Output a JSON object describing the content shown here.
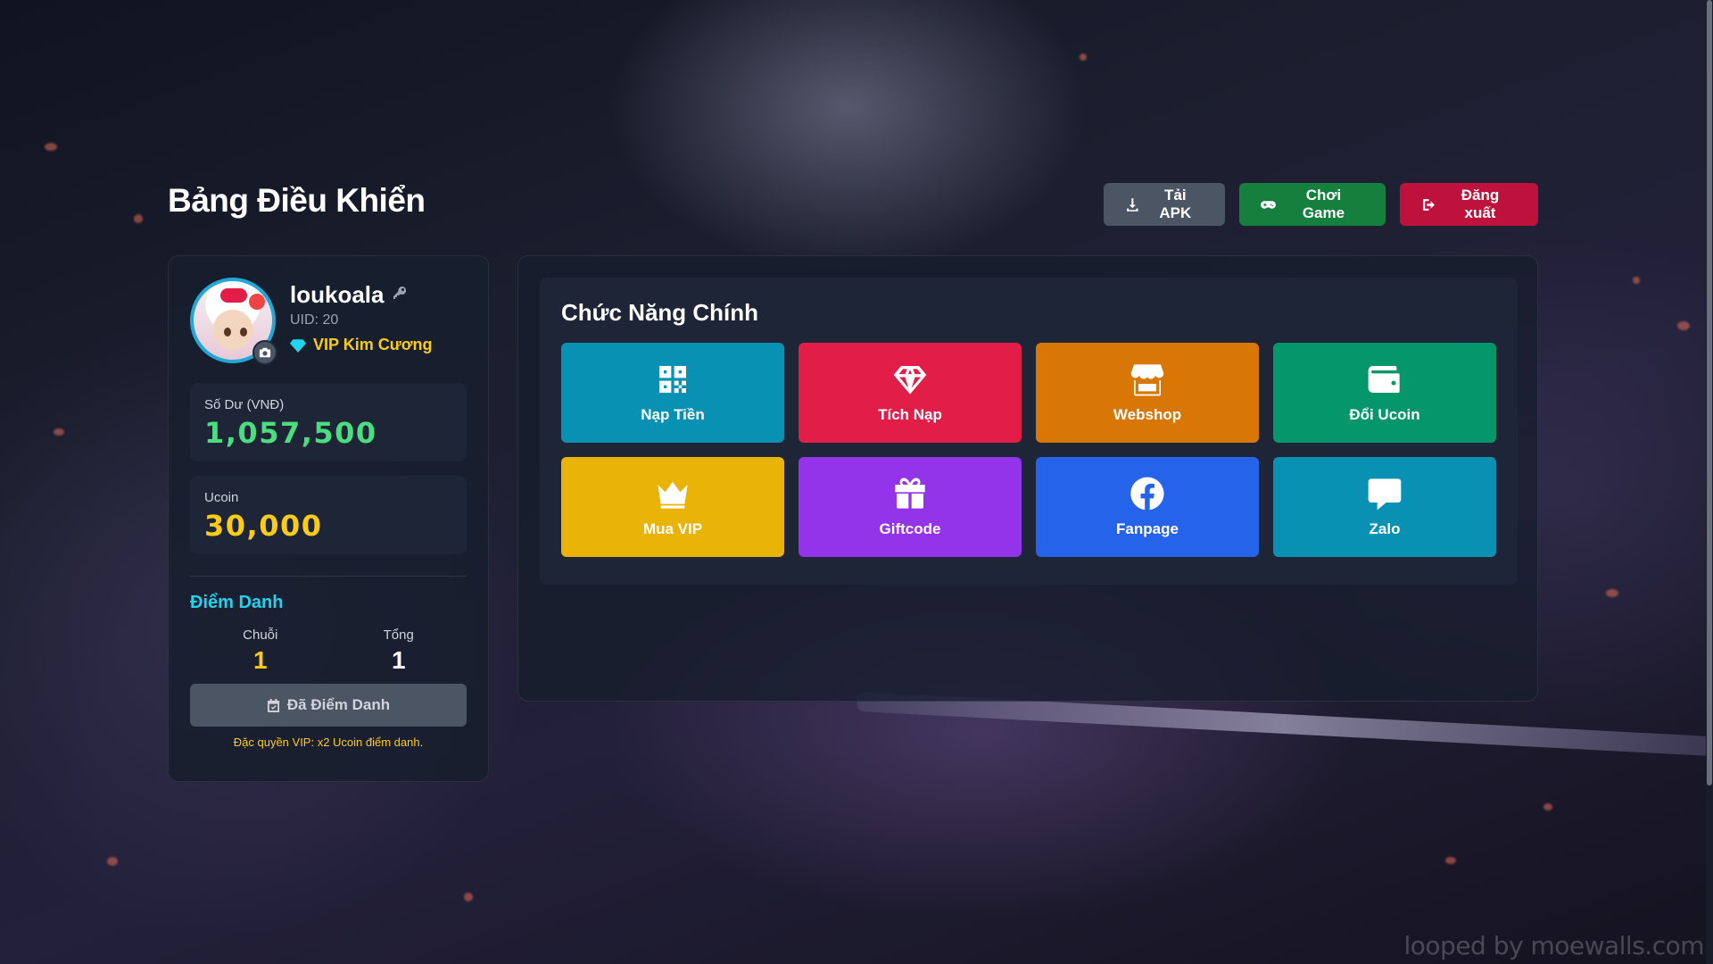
{
  "page_title": "Bảng Điều Khiển",
  "top_actions": {
    "apk_label": "Tải APK",
    "play_label": "Chơi Game",
    "logout_label": "Đăng xuất"
  },
  "profile": {
    "username": "loukoala",
    "uid": "UID: 20",
    "vip_level": "VIP Kim Cương"
  },
  "balance": {
    "label": "Số Dư (VNĐ)",
    "value": "1,057,500"
  },
  "ucoin": {
    "label": "Ucoin",
    "value": "30,000"
  },
  "checkin": {
    "title": "Điểm Danh",
    "chain_label": "Chuỗi",
    "chain_value": "1",
    "total_label": "Tổng",
    "total_value": "1",
    "button_label": "Đã Điểm Danh",
    "vip_note": "Đặc quyền VIP: x2 Ucoin điểm danh."
  },
  "features": {
    "title": "Chức Năng Chính",
    "tiles": [
      {
        "label": "Nạp Tiền",
        "icon": "qrcode-icon",
        "color": "#0891b2"
      },
      {
        "label": "Tích Nạp",
        "icon": "gem-icon",
        "color": "#e11d48"
      },
      {
        "label": "Webshop",
        "icon": "store-icon",
        "color": "#d97706"
      },
      {
        "label": "Đổi Ucoin",
        "icon": "wallet-icon",
        "color": "#059669"
      },
      {
        "label": "Mua VIP",
        "icon": "crown-icon",
        "color": "#eab308"
      },
      {
        "label": "Giftcode",
        "icon": "gift-icon",
        "color": "#9333ea"
      },
      {
        "label": "Fanpage",
        "icon": "facebook-icon",
        "color": "#2563eb"
      },
      {
        "label": "Zalo",
        "icon": "chat-icon",
        "color": "#0891b2"
      }
    ]
  },
  "watermark": "looped by moewalls.com"
}
